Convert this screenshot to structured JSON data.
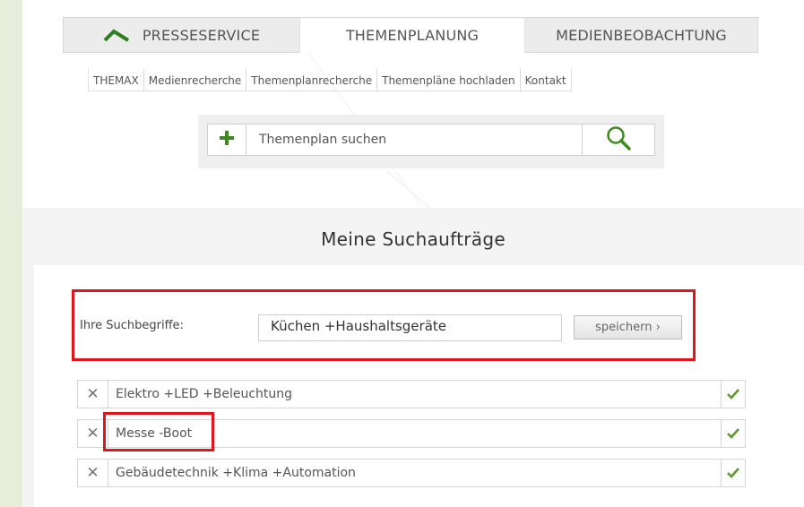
{
  "tabs": [
    {
      "label": "PRESSESERVICE",
      "icon": "roof-logo-icon"
    },
    {
      "label": "THEMENPLANUNG"
    },
    {
      "label": "MEDIENBEOBACHTUNG"
    }
  ],
  "subnav": [
    "THEMAX",
    "Medienrecherche",
    "Themenplanrecherche",
    "Themenpläne hochladen",
    "Kontakt"
  ],
  "search": {
    "placeholder": "Themenplan suchen",
    "add_icon": "plus-icon",
    "search_icon": "magnifier-icon"
  },
  "heading": "Meine Suchaufträge",
  "form": {
    "label": "Ihre Suchbegriffe:",
    "value": "Küchen +Haushaltsgeräte",
    "save_label": "speichern ›"
  },
  "saved_searches": [
    {
      "text": "Elektro +LED +Beleuchtung",
      "remove": "✕"
    },
    {
      "text": "Messe -Boot",
      "remove": "✕"
    },
    {
      "text": "Gebäudetechnik +Klima +Automation",
      "remove": "✕"
    }
  ],
  "colors": {
    "accent": "#5a9a2e",
    "highlight": "#e3141c",
    "background": "#e6eedb"
  }
}
